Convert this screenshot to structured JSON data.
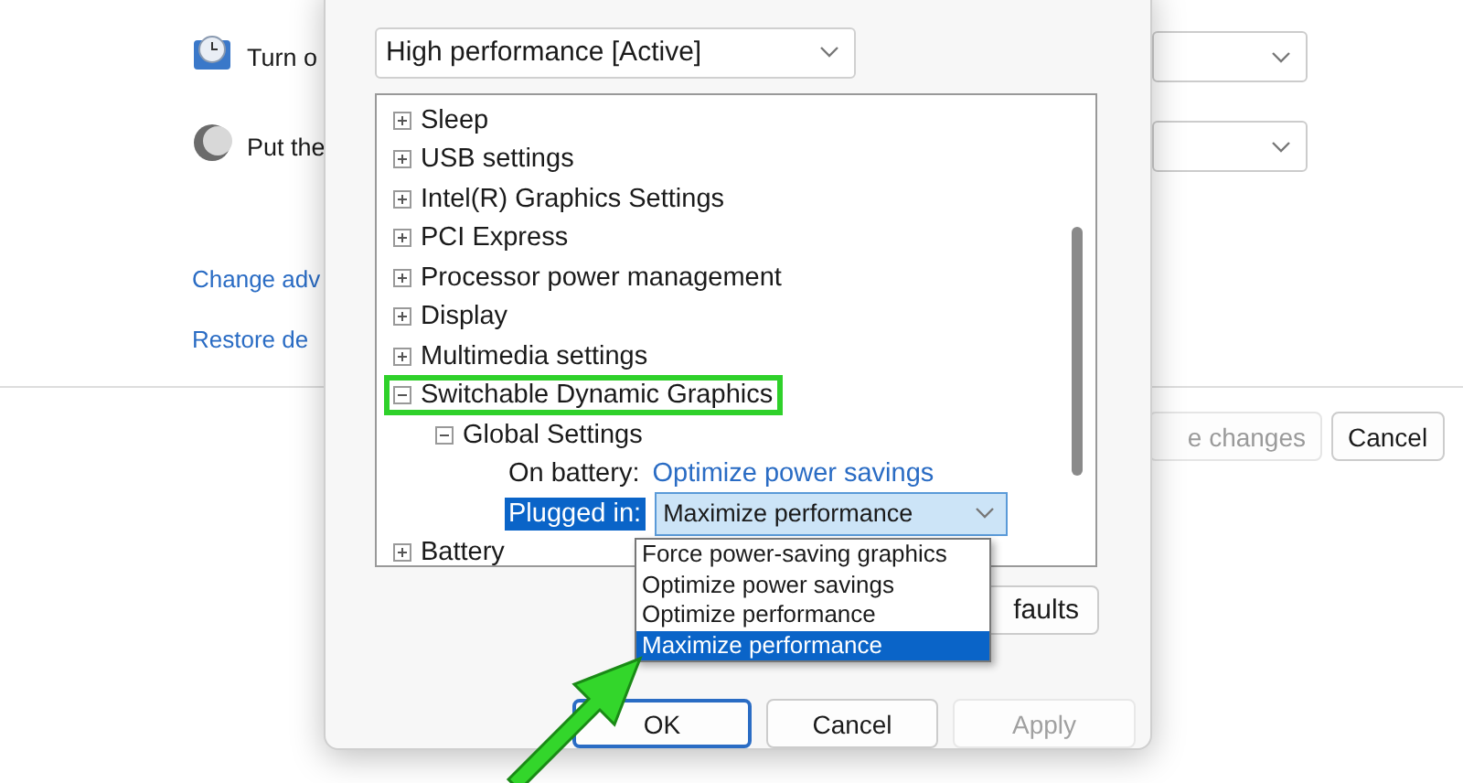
{
  "background_window": {
    "rows": [
      {
        "kind": "clock",
        "label": "Turn o"
      },
      {
        "kind": "moon",
        "label": "Put the"
      }
    ],
    "links": [
      "Change adv",
      "Restore de"
    ],
    "buttons": [
      {
        "label": "e changes",
        "disabled": true
      },
      {
        "label": "Cancel",
        "disabled": false
      }
    ]
  },
  "dialog": {
    "plan_select": {
      "value": "High performance [Active]"
    },
    "tree": [
      {
        "label": "Sleep",
        "expanded": false,
        "highlighted": false
      },
      {
        "label": "USB settings",
        "expanded": false,
        "highlighted": false
      },
      {
        "label": "Intel(R) Graphics Settings",
        "expanded": false,
        "highlighted": false
      },
      {
        "label": "PCI Express",
        "expanded": false,
        "highlighted": false
      },
      {
        "label": "Processor power management",
        "expanded": false,
        "highlighted": false
      },
      {
        "label": "Display",
        "expanded": false,
        "highlighted": false
      },
      {
        "label": "Multimedia settings",
        "expanded": false,
        "highlighted": false
      },
      {
        "label": "Switchable Dynamic Graphics",
        "expanded": true,
        "highlighted": true,
        "children": [
          {
            "label": "Global Settings",
            "expanded": true,
            "highlighted": false,
            "children": [
              {
                "kind": "link",
                "label": "On battery:",
                "value": "Optimize power savings",
                "selected": false
              },
              {
                "kind": "select",
                "label": "Plugged in:",
                "value": "Maximize performance",
                "selected": true
              }
            ]
          }
        ]
      },
      {
        "label": "Battery",
        "expanded": false,
        "highlighted": false
      }
    ],
    "restore_button": "faults",
    "dropdown_options": [
      {
        "label": "Force power-saving graphics",
        "selected": false
      },
      {
        "label": "Optimize power savings",
        "selected": false
      },
      {
        "label": "Optimize performance",
        "selected": false
      },
      {
        "label": "Maximize performance",
        "selected": true
      }
    ],
    "buttons": [
      {
        "label": "OK",
        "default": true,
        "disabled": false
      },
      {
        "label": "Cancel",
        "default": false,
        "disabled": false
      },
      {
        "label": "Apply",
        "default": false,
        "disabled": true
      }
    ]
  }
}
